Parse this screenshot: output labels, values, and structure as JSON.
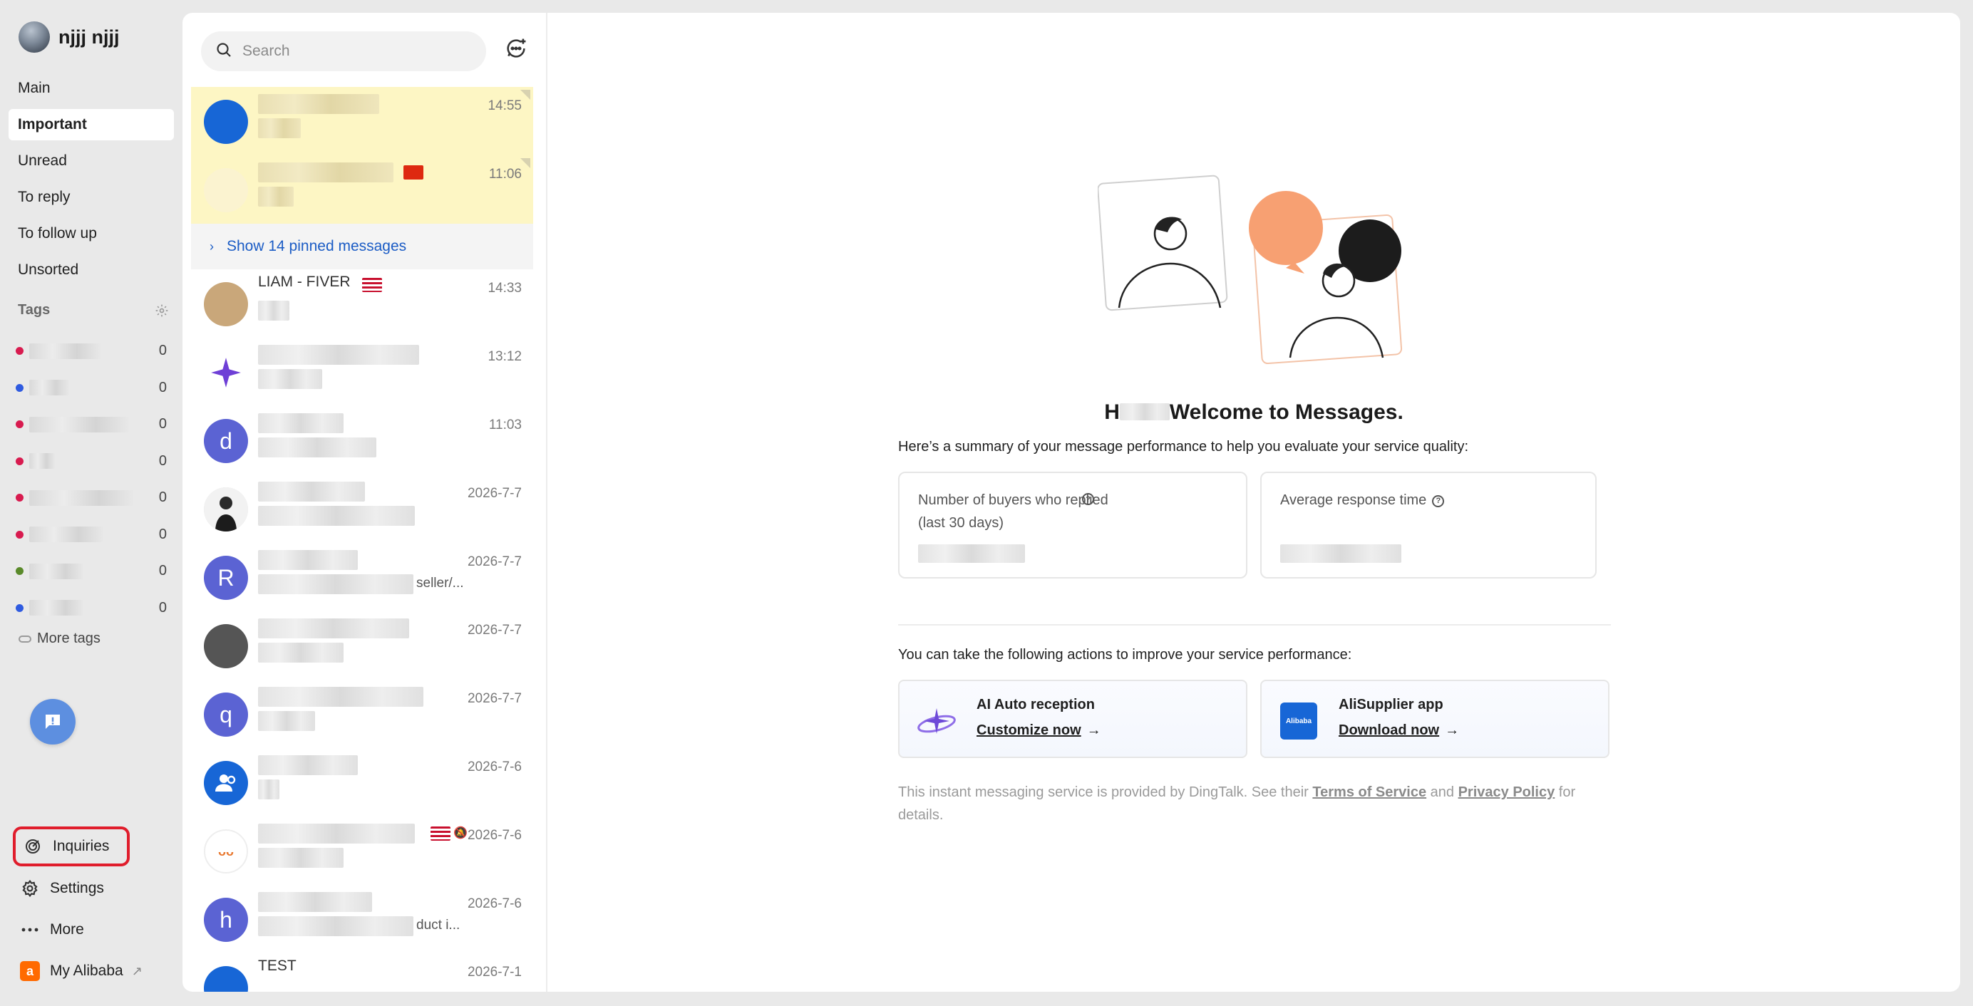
{
  "user": {
    "name": "njjj njjj"
  },
  "nav": {
    "items": [
      {
        "label": "Main"
      },
      {
        "label": "Important",
        "active": true
      },
      {
        "label": "Unread"
      },
      {
        "label": "To reply"
      },
      {
        "label": "To follow up"
      },
      {
        "label": "Unsorted"
      }
    ]
  },
  "tags": {
    "title": "Tags",
    "items": [
      {
        "color": "#d81b4f",
        "count": "0"
      },
      {
        "color": "#2f5be0",
        "count": "0"
      },
      {
        "color": "#d81b4f",
        "count": "0"
      },
      {
        "color": "#d81b4f",
        "count": "0"
      },
      {
        "color": "#d81b4f",
        "count": "0"
      },
      {
        "color": "#d81b4f",
        "count": "0"
      },
      {
        "color": "#5a8a2a",
        "count": "0"
      },
      {
        "color": "#2f5be0",
        "count": "0"
      }
    ],
    "more_label": "More tags"
  },
  "bottom_nav": {
    "inquiries": "Inquiries",
    "settings": "Settings",
    "more": "More",
    "my_alibaba": "My Alibaba"
  },
  "search": {
    "placeholder": "Search"
  },
  "pinned": {
    "items": [
      {
        "time": "14:55"
      },
      {
        "time": "11:06"
      }
    ],
    "toggle_label": "Show 14 pinned messages"
  },
  "conversations": [
    {
      "name": "LIAM - FIVER",
      "time": "14:33",
      "avatar_letter": "",
      "avatar_color": "#c9a77a"
    },
    {
      "time": "13:12",
      "avatar_letter": "",
      "avatar_color": "#ffffff"
    },
    {
      "time": "11:03",
      "avatar_letter": "d",
      "avatar_color": "#5b63d3"
    },
    {
      "time": "2026-7-7",
      "avatar_letter": "",
      "avatar_color": "#dcdcdc"
    },
    {
      "time": "2026-7-7",
      "avatar_letter": "R",
      "avatar_color": "#5b63d3",
      "snippet": "seller/..."
    },
    {
      "time": "2026-7-7",
      "avatar_letter": "",
      "avatar_color": "#555555"
    },
    {
      "time": "2026-7-7",
      "avatar_letter": "q",
      "avatar_color": "#5b63d3"
    },
    {
      "time": "2026-7-6",
      "avatar_letter": "",
      "avatar_color": "#1766d6"
    },
    {
      "time": "2026-7-6",
      "avatar_letter": "",
      "avatar_color": "#ffffff"
    },
    {
      "time": "2026-7-6",
      "avatar_letter": "h",
      "avatar_color": "#5b63d3",
      "snippet": "duct i..."
    },
    {
      "name": "TEST",
      "time": "2026-7-1",
      "avatar_letter": "",
      "avatar_color": "#1766d6"
    }
  ],
  "welcome": {
    "title_prefix": "H",
    "title_suffix": "Welcome to Messages.",
    "summary": "Here’s a summary of your message performance to help you evaluate your service quality:",
    "stat1_label": "Number of buyers who replied (last 30 days)",
    "stat2_label": "Average response time",
    "actions_title": "You can take the following actions to improve your service performance:",
    "action1_title": "AI Auto reception",
    "action1_link": "Customize now",
    "action2_title": "AliSupplier app",
    "action2_link": "Download now",
    "footer_prefix": "This instant messaging service is provided by DingTalk. See their ",
    "footer_tos": "Terms of Service",
    "footer_and": " and ",
    "footer_privacy": "Privacy Policy",
    "footer_suffix": " for details."
  },
  "colors": {
    "accent_blue": "#1b5cc5",
    "highlight_red": "#e01d2c",
    "illustration_orange": "#f7a072",
    "pinned_bg": "#fdf6c4"
  }
}
